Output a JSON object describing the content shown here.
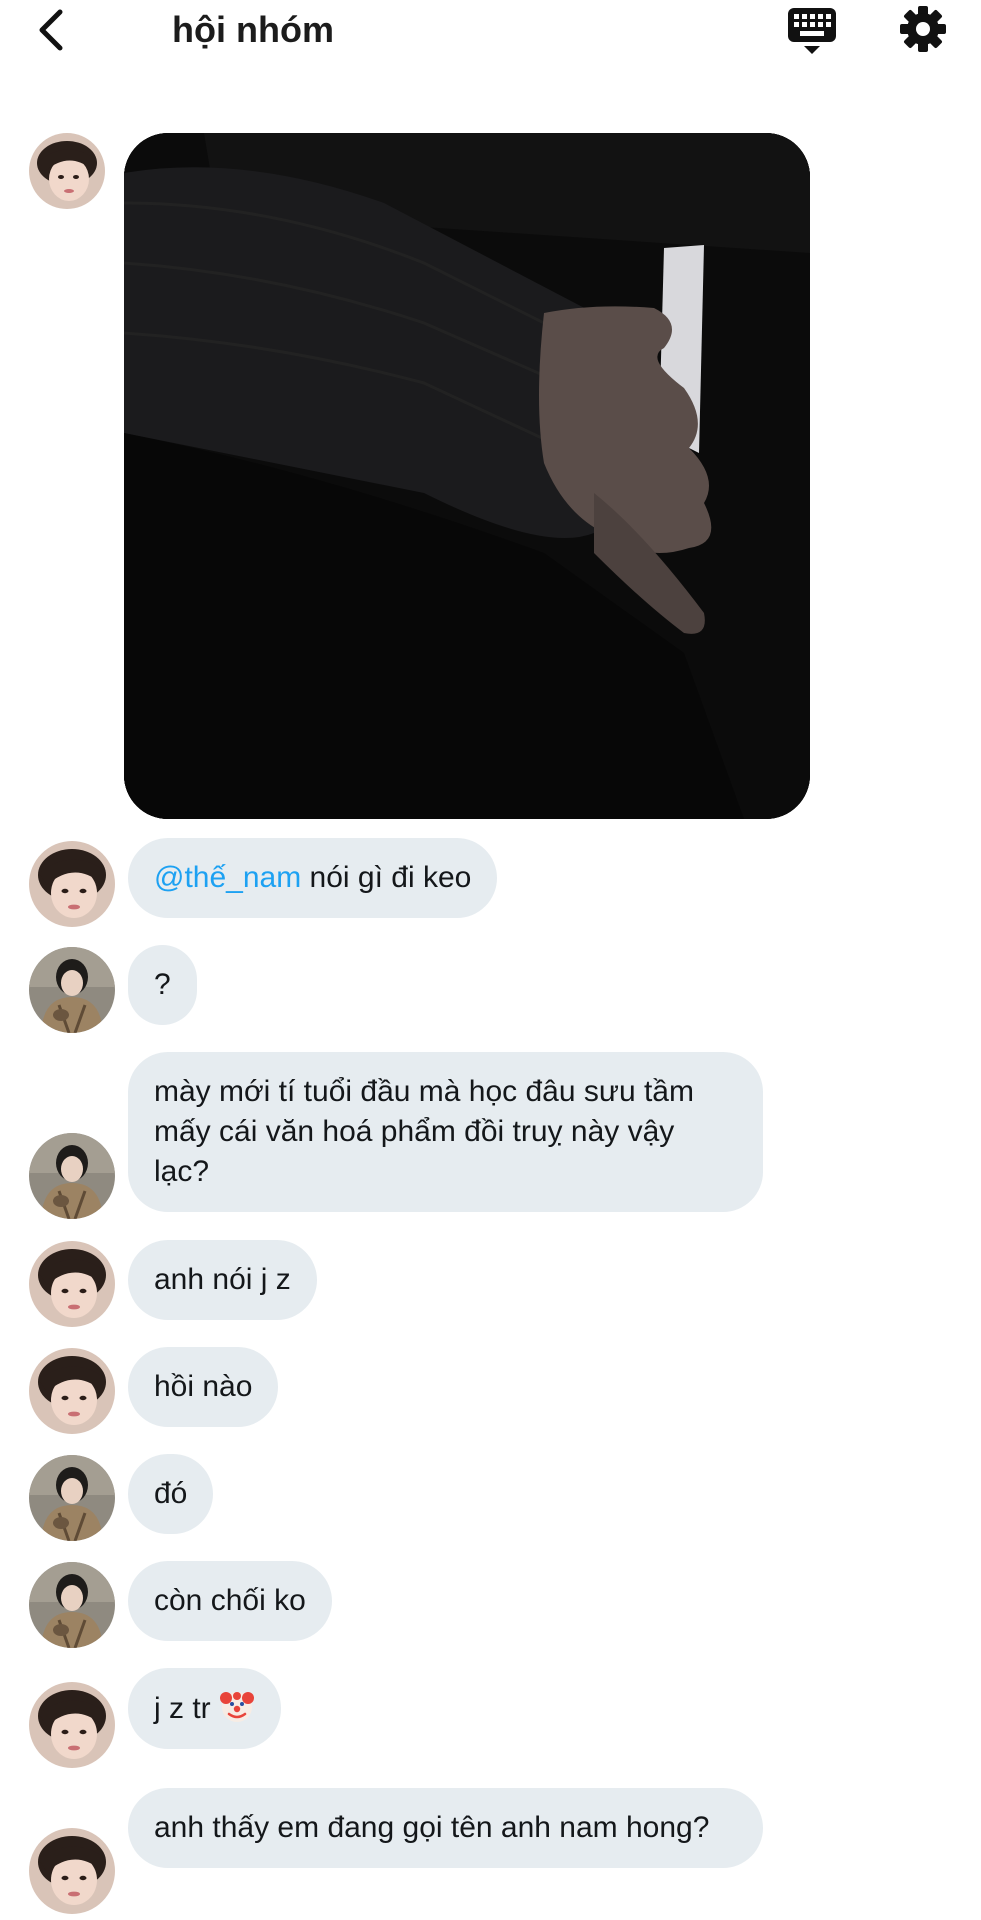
{
  "header": {
    "title": "hội nhóm",
    "back_icon": "chevron-left-icon",
    "keyboard_icon": "keyboard-icon",
    "settings_icon": "gear-icon"
  },
  "colors": {
    "bubble": "#e6ecf0",
    "mention": "#1da1f2",
    "text": "#14171a"
  },
  "messages": [
    {
      "sender": "user-a",
      "type": "image"
    },
    {
      "sender": "user-a",
      "mention": "@thế_nam",
      "text": " nói gì đi keo"
    },
    {
      "sender": "user-b",
      "text": "?"
    },
    {
      "sender": "user-b",
      "text": "mày mới tí tuổi đầu mà học đâu sưu tầm mấy cái văn hoá phẩm đồi truỵ này vậy lạc?"
    },
    {
      "sender": "user-a",
      "text": "anh nói j z"
    },
    {
      "sender": "user-a",
      "text": "hồi nào"
    },
    {
      "sender": "user-b",
      "text": "đó"
    },
    {
      "sender": "user-b",
      "text": "còn chối ko"
    },
    {
      "sender": "user-a",
      "text": "j z tr",
      "emoji": "clown-face-icon"
    },
    {
      "sender": "user-a",
      "text": "anh thấy em đang gọi tên anh nam hong?"
    }
  ]
}
